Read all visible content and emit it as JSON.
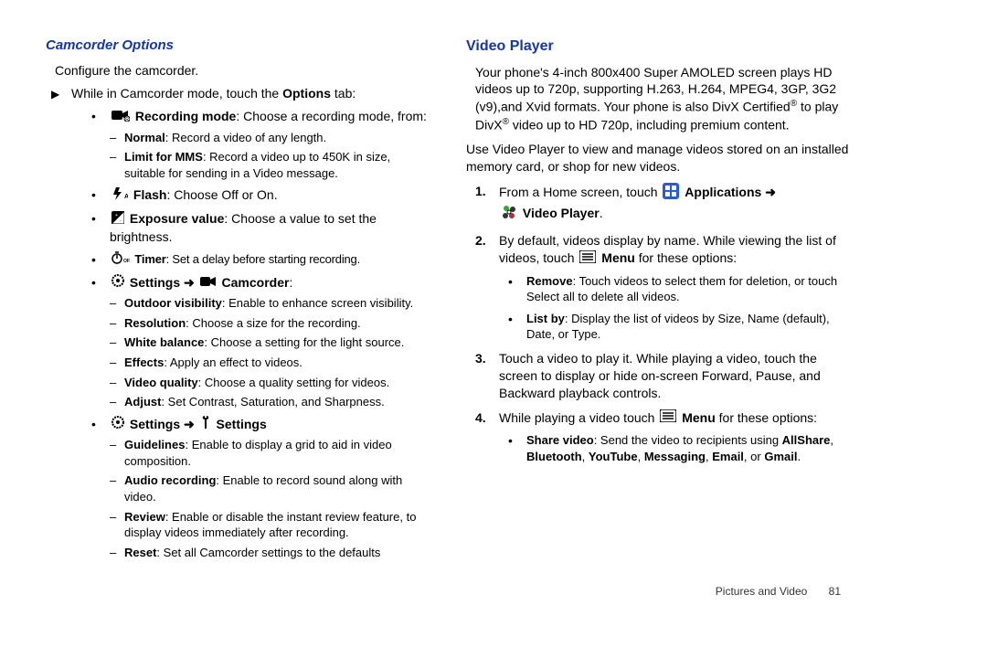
{
  "left": {
    "heading": "Camcorder Options",
    "intro": "Configure the camcorder.",
    "step_marker": "▶",
    "step_text_a": "While in Camcorder mode, touch the ",
    "step_text_b": "Options",
    "step_text_c": " tab:",
    "recmode_label": "Recording mode",
    "recmode_text": ": Choose a recording mode, from:",
    "rec_normal_b": "Normal",
    "rec_normal_t": ": Record a video of any length.",
    "rec_mms_b": "Limit for MMS",
    "rec_mms_t": ": Record a video up to 450K in size, suitable for sending in a Video message.",
    "flash_label": "Flash",
    "flash_text": ": Choose Off or On.",
    "exp_label": "Exposure value",
    "exp_text": ": Choose a value to set the brightness.",
    "timer_label": "Timer",
    "timer_text": ": Set a delay before starting recording.",
    "settings_label": "Settings",
    "arrow": "➜",
    "camcorder_label": "Camcorder",
    "settings2_label": "Settings",
    "outdoor_b": "Outdoor visibility",
    "outdoor_t": ": Enable to enhance screen visibility.",
    "reso_b": "Resolution",
    "reso_t": ": Choose a size for the recording.",
    "wb_b": "White balance",
    "wb_t": ": Choose a setting for the light source.",
    "fx_b": "Effects",
    "fx_t": ": Apply an effect to videos.",
    "vq_b": "Video quality",
    "vq_t": ": Choose a quality setting for videos.",
    "adj_b": "Adjust",
    "adj_t": ": Set Contrast, Saturation, and Sharpness.",
    "guide_b": "Guidelines",
    "guide_t": ": Enable to display a grid to aid in video composition.",
    "audio_b": "Audio recording",
    "audio_t": ": Enable to record sound along with video.",
    "review_b": "Review",
    "review_t": ": Enable or disable the instant review feature, to display videos immediately after recording.",
    "reset_b": "Reset",
    "reset_t": ": Set all Camcorder settings to the defaults"
  },
  "right": {
    "heading": "Video Player",
    "p1a": "Your phone's 4-inch 800x400 Super AMOLED screen plays HD videos up to 720p, supporting H.263, H.264, MPEG4, 3GP, 3G2 (v9),and Xvid formats. Your phone is also DivX Certified",
    "p1b": " to play DivX",
    "p1c": " video up to HD 720p, including premium content.",
    "p2": "Use Video Player to view and manage videos stored on an installed memory card, or shop for new videos.",
    "s1a": "From a Home screen, touch ",
    "apps_label": "Applications",
    "vp_label": "Video Player",
    "s2a": "By default, videos display by name. While viewing the list of videos, touch ",
    "menu_label": "Menu",
    "s2b": "  for these options:",
    "remove_b": "Remove",
    "remove_t": ": Touch videos to select them for deletion, or touch Select all to delete all videos.",
    "listby_b": "List by",
    "listby_t": ": Display the list of videos by Size, Name (default), Date, or Type.",
    "s3": "Touch a video to play it. While playing a video, touch the screen to display or hide on-screen Forward, Pause, and Backward playback controls.",
    "s4a": "While playing a video touch ",
    "s4b": " for these options:",
    "share_b": "Share video",
    "share_t1": ": Send the video to recipients using ",
    "share_allshare": "AllShare",
    "share_bt": "Bluetooth",
    "share_yt": "YouTube",
    "share_msg": "Messaging",
    "share_em": "Email",
    "share_or": ", or ",
    "share_gm": "Gmail",
    "reg": "®"
  },
  "footer": {
    "section": "Pictures and Video",
    "page": "81"
  }
}
